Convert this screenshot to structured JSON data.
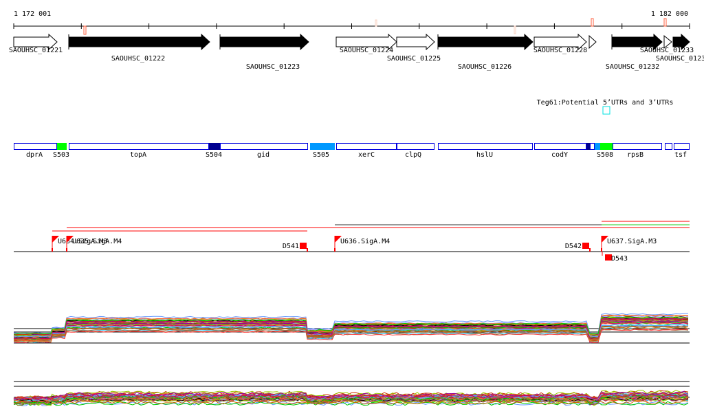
{
  "ruler": {
    "start_label": "1 172 001",
    "end_label": "1 182 000"
  },
  "genes": [
    {
      "label": "SAOUHSC_01221",
      "strand": "+",
      "style": "open"
    },
    {
      "label": "SAOUHSC_01222",
      "strand": "+",
      "style": "filled"
    },
    {
      "label": "SAOUHSC_01223",
      "strand": "+",
      "style": "filled"
    },
    {
      "label": "SAOUHSC_01224",
      "strand": "+",
      "style": "open"
    },
    {
      "label": "SAOUHSC_01225",
      "strand": "+",
      "style": "open"
    },
    {
      "label": "SAOUHSC_01226",
      "strand": "+",
      "style": "filled"
    },
    {
      "label": "SAOUHSC_01228",
      "strand": "+",
      "style": "open"
    },
    {
      "label": "",
      "strand": "+",
      "style": "open"
    },
    {
      "label": "SAOUHSC_01232",
      "strand": "+",
      "style": "filled"
    },
    {
      "label": "SAOUHSC_01233",
      "strand": "+",
      "style": "open"
    },
    {
      "label": "SAOUHSC_0123",
      "strand": "+",
      "style": "filled"
    }
  ],
  "teg": {
    "label": "Teg61:Potential 5’UTRs and 3’UTRs",
    "color": "#00e0e0"
  },
  "features": [
    {
      "label": "dprA",
      "fill": "#ffffff"
    },
    {
      "label": "S503",
      "fill": "#00ff00"
    },
    {
      "label": "topA",
      "fill": "#ffffff"
    },
    {
      "label": "S504",
      "fill": "#000090"
    },
    {
      "label": "gid",
      "fill": "#ffffff"
    },
    {
      "label": "S505",
      "fill": "#0099ff"
    },
    {
      "label": "xerC",
      "fill": "#ffffff"
    },
    {
      "label": "clpQ",
      "fill": "#ffffff"
    },
    {
      "label": "hslU",
      "fill": "#ffffff"
    },
    {
      "label": "codY",
      "fill": "#ffffff"
    },
    {
      "label": "",
      "fill": "#000090"
    },
    {
      "label": "",
      "fill": "#ffffff"
    },
    {
      "label": "",
      "fill": "#0099ff"
    },
    {
      "label": "S508",
      "fill": "#00ff00"
    },
    {
      "label": "rpsB",
      "fill": "#ffffff"
    },
    {
      "label": "",
      "fill": "#ffffff"
    },
    {
      "label": "tsf",
      "fill": "#ffffff"
    }
  ],
  "sites": [
    {
      "label": "U634.SigA.M3",
      "type": "up"
    },
    {
      "label": "U635.SigA.M4",
      "type": "up"
    },
    {
      "label": "D541",
      "type": "down"
    },
    {
      "label": "U636.SigA.M4",
      "type": "up"
    },
    {
      "label": "D542",
      "type": "down"
    },
    {
      "label": "U637.SigA.M3",
      "type": "up"
    },
    {
      "label": "D543",
      "type": "down"
    }
  ],
  "colors": {
    "site": "#ff0000",
    "feature_border": "#0000e0",
    "marker": "#ff6040"
  }
}
